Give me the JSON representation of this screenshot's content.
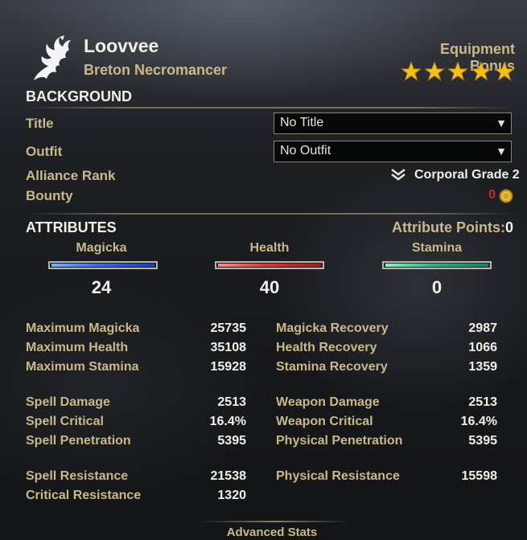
{
  "character": {
    "name": "Loovvee",
    "race_class": "Breton Necromancer",
    "emblem_icon": "dragon-emblem-icon"
  },
  "equipment_bonus": {
    "label": "Equipment Bonus",
    "stars": 5,
    "star_color": "#f2c017"
  },
  "background": {
    "heading": "BACKGROUND",
    "title_label": "Title",
    "title_value": "No Title",
    "outfit_label": "Outfit",
    "outfit_value": "No Outfit",
    "alliance_rank_label": "Alliance Rank",
    "alliance_rank_value": "Corporal Grade 2",
    "rank_icon": "chevron-rank-icon",
    "bounty_label": "Bounty",
    "bounty_value": "0",
    "bounty_color": "#d22a1e",
    "gold_icon": "gold-coin-icon"
  },
  "attributes": {
    "heading": "ATTRIBUTES",
    "points_label": "Attribute Points:",
    "points_value": "0",
    "magicka_label": "Magicka",
    "magicka_value": "24",
    "health_label": "Health",
    "health_value": "40",
    "stamina_label": "Stamina",
    "stamina_value": "0",
    "colors": {
      "magicka": "#2f6df0",
      "health": "#e0343a",
      "stamina": "#26b88a"
    }
  },
  "stats": {
    "left": [
      {
        "label": "Maximum Magicka",
        "value": "25735"
      },
      {
        "label": "Maximum Health",
        "value": "35108"
      },
      {
        "label": "Maximum Stamina",
        "value": "15928"
      },
      {
        "label": "Spell Damage",
        "value": "2513"
      },
      {
        "label": "Spell Critical",
        "value": "16.4%"
      },
      {
        "label": "Spell Penetration",
        "value": "5395"
      },
      {
        "label": "Spell Resistance",
        "value": "21538"
      },
      {
        "label": "Critical Resistance",
        "value": "1320"
      }
    ],
    "right": [
      {
        "label": "Magicka Recovery",
        "value": "2987"
      },
      {
        "label": "Health Recovery",
        "value": "1066"
      },
      {
        "label": "Stamina Recovery",
        "value": "1359"
      },
      {
        "label": "Weapon Damage",
        "value": "2513"
      },
      {
        "label": "Weapon Critical",
        "value": "16.4%"
      },
      {
        "label": "Physical Penetration",
        "value": "5395"
      },
      {
        "label": "Physical Resistance",
        "value": "15598"
      }
    ]
  },
  "footer": {
    "advanced_stats_label": "Advanced Stats"
  }
}
